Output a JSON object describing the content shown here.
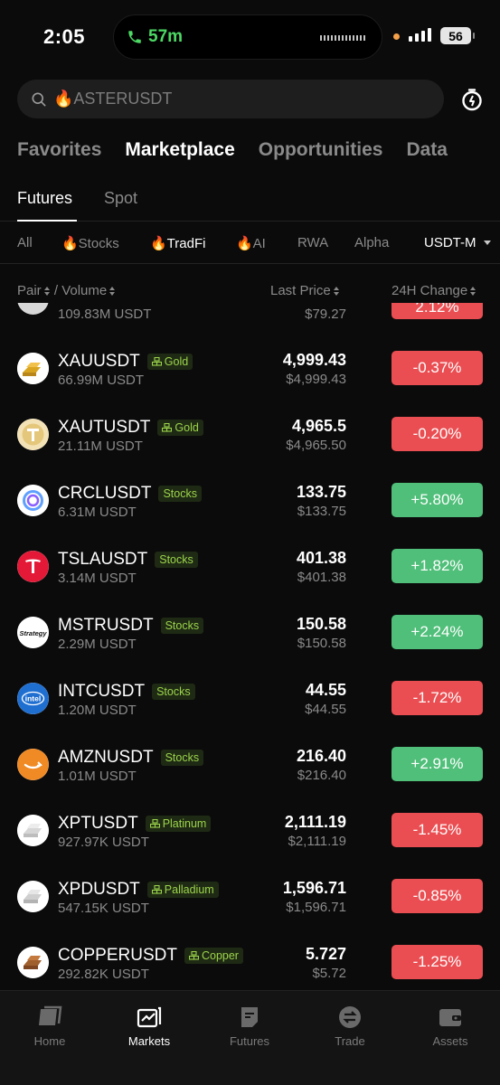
{
  "status": {
    "time": "2:05",
    "call_duration": "57m",
    "battery": "56"
  },
  "search": {
    "placeholder": "🔥ASTERUSDT"
  },
  "main_tabs": [
    {
      "label": "Favorites"
    },
    {
      "label": "Marketplace"
    },
    {
      "label": "Opportunities"
    },
    {
      "label": "Data"
    }
  ],
  "sub_tabs": [
    {
      "label": "Futures"
    },
    {
      "label": "Spot"
    }
  ],
  "filters": [
    {
      "label": "All"
    },
    {
      "label": "🔥Stocks"
    },
    {
      "label": "🔥TradFi"
    },
    {
      "label": "🔥AI"
    },
    {
      "label": "RWA"
    },
    {
      "label": "Alpha"
    }
  ],
  "quote_select": "USDT-M",
  "columns": {
    "pair": "Pair",
    "volume": "Volume",
    "last_price": "Last Price",
    "change": "24H Change"
  },
  "partial_row": {
    "volume": "109.83M USDT",
    "price_usd": "$79.27",
    "change": "2.12%"
  },
  "rows": [
    {
      "pair": "XAUUSDT",
      "tag": "Gold",
      "tag_icon": "commodity-icon",
      "volume": "66.99M USDT",
      "price": "4,999.43",
      "price_usd": "$4,999.43",
      "change": "-0.37%",
      "direction": "down",
      "logo": "gold-bars"
    },
    {
      "pair": "XAUTUSDT",
      "tag": "Gold",
      "tag_icon": "commodity-icon",
      "volume": "21.11M USDT",
      "price": "4,965.5",
      "price_usd": "$4,965.50",
      "change": "-0.20%",
      "direction": "down",
      "logo": "tether-gold"
    },
    {
      "pair": "CRCLUSDT",
      "tag": "Stocks",
      "tag_icon": "",
      "volume": "6.31M USDT",
      "price": "133.75",
      "price_usd": "$133.75",
      "change": "+5.80%",
      "direction": "up",
      "logo": "circle"
    },
    {
      "pair": "TSLAUSDT",
      "tag": "Stocks",
      "tag_icon": "",
      "volume": "3.14M USDT",
      "price": "401.38",
      "price_usd": "$401.38",
      "change": "+1.82%",
      "direction": "up",
      "logo": "tesla"
    },
    {
      "pair": "MSTRUSDT",
      "tag": "Stocks",
      "tag_icon": "",
      "volume": "2.29M USDT",
      "price": "150.58",
      "price_usd": "$150.58",
      "change": "+2.24%",
      "direction": "up",
      "logo": "strategy"
    },
    {
      "pair": "INTCUSDT",
      "tag": "Stocks",
      "tag_icon": "",
      "volume": "1.20M USDT",
      "price": "44.55",
      "price_usd": "$44.55",
      "change": "-1.72%",
      "direction": "down",
      "logo": "intel"
    },
    {
      "pair": "AMZNUSDT",
      "tag": "Stocks",
      "tag_icon": "",
      "volume": "1.01M USDT",
      "price": "216.40",
      "price_usd": "$216.40",
      "change": "+2.91%",
      "direction": "up",
      "logo": "amazon"
    },
    {
      "pair": "XPTUSDT",
      "tag": "Platinum",
      "tag_icon": "commodity-icon",
      "volume": "927.97K USDT",
      "price": "2,111.19",
      "price_usd": "$2,111.19",
      "change": "-1.45%",
      "direction": "down",
      "logo": "platinum-bars"
    },
    {
      "pair": "XPDUSDT",
      "tag": "Palladium",
      "tag_icon": "commodity-icon",
      "volume": "547.15K USDT",
      "price": "1,596.71",
      "price_usd": "$1,596.71",
      "change": "-0.85%",
      "direction": "down",
      "logo": "palladium-bars"
    },
    {
      "pair": "COPPERUSDT",
      "tag": "Copper",
      "tag_icon": "commodity-icon",
      "volume": "292.82K USDT",
      "price": "5.727",
      "price_usd": "$5.72",
      "change": "-1.25%",
      "direction": "down",
      "logo": "copper-bars"
    }
  ],
  "intel_logo_text": "intel",
  "strategy_logo_text": "Strategy",
  "bottom_nav": [
    {
      "label": "Home",
      "icon": "home-icon"
    },
    {
      "label": "Markets",
      "icon": "markets-icon"
    },
    {
      "label": "Futures",
      "icon": "futures-icon"
    },
    {
      "label": "Trade",
      "icon": "trade-icon"
    },
    {
      "label": "Assets",
      "icon": "assets-icon"
    }
  ],
  "colors": {
    "background": "#0b0b0b",
    "negative": "#ea4e52",
    "positive": "#4fbf79",
    "tag_text": "#9bd44b",
    "muted": "#8a8a8a"
  }
}
